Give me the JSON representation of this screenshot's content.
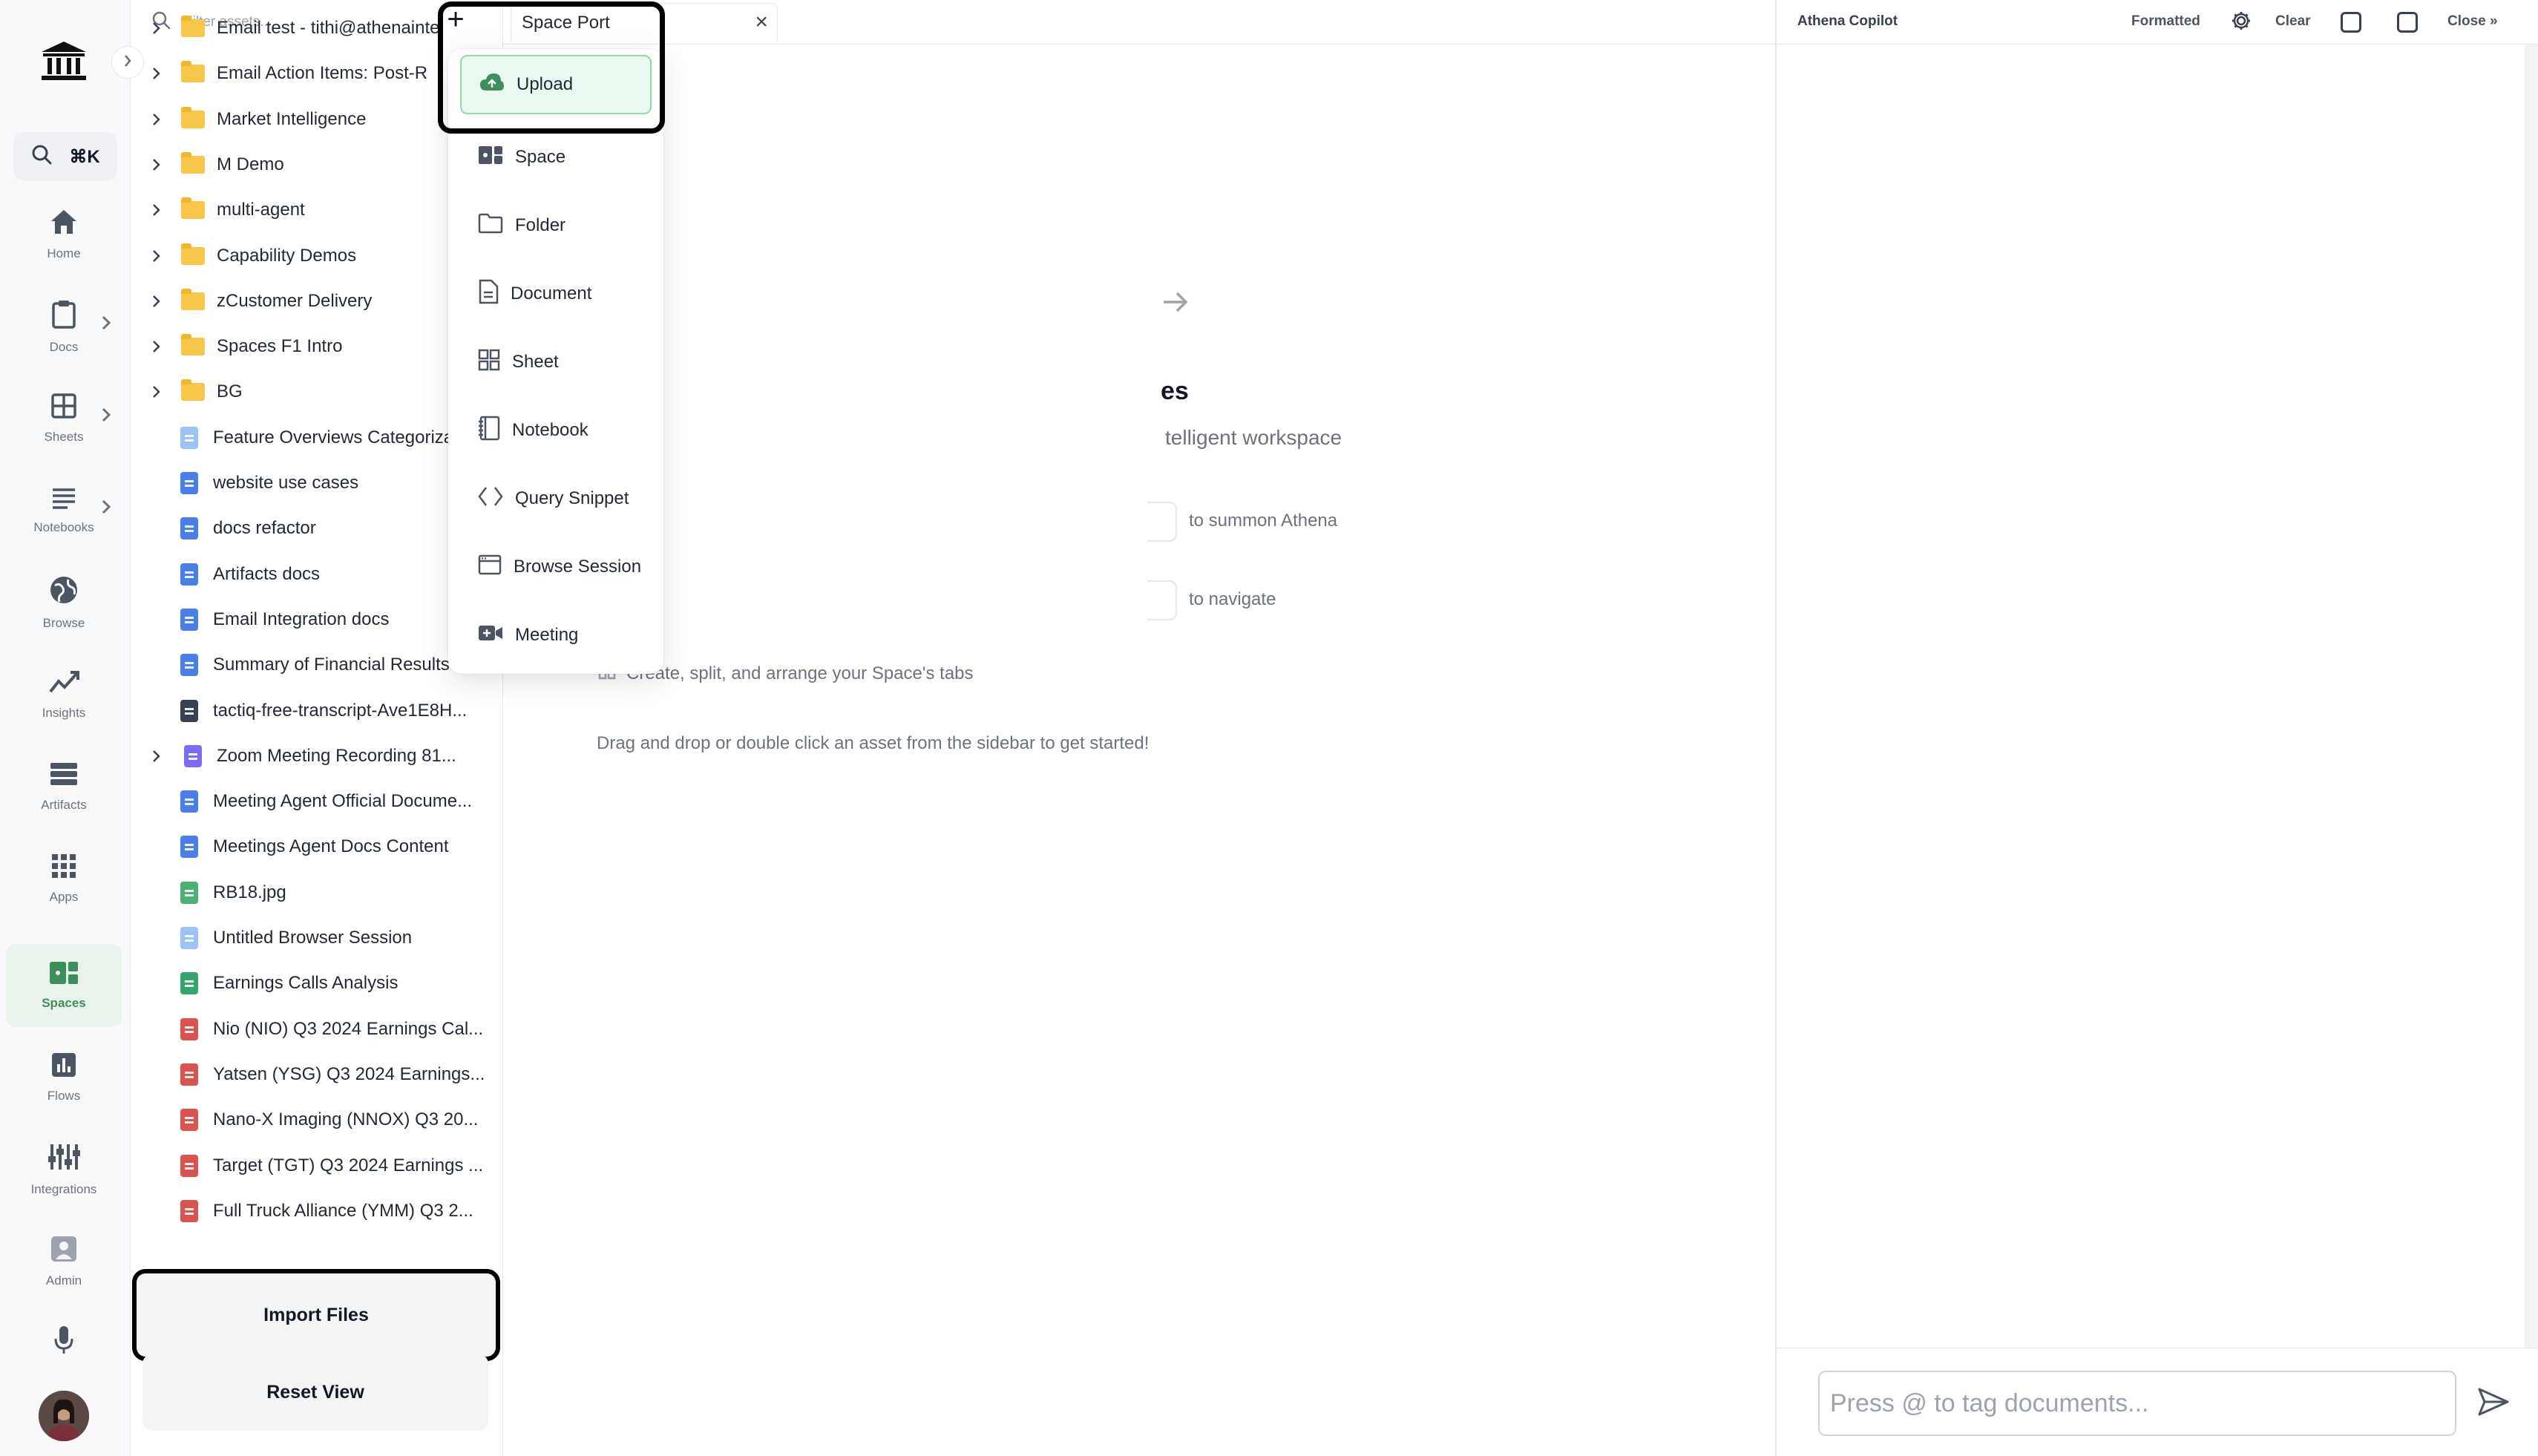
{
  "rail": {
    "search_shortcut": "⌘K",
    "items": [
      {
        "label": "Home",
        "icon": "home-icon"
      },
      {
        "label": "Docs",
        "icon": "clipboard-icon"
      },
      {
        "label": "Sheets",
        "icon": "grid-icon"
      },
      {
        "label": "Notebooks",
        "icon": "lines-icon"
      },
      {
        "label": "Browse",
        "icon": "globe-icon"
      },
      {
        "label": "Insights",
        "icon": "trend-icon"
      },
      {
        "label": "Artifacts",
        "icon": "stack-icon"
      },
      {
        "label": "Apps",
        "icon": "apps-grid-icon"
      },
      {
        "label": "Spaces",
        "icon": "spaces-icon",
        "active": true
      },
      {
        "label": "Flows",
        "icon": "bar-chart-icon"
      },
      {
        "label": "Integrations",
        "icon": "sliders-icon"
      },
      {
        "label": "Admin",
        "icon": "admin-icon"
      }
    ]
  },
  "assets": {
    "filter_placeholder": "Filter assets...",
    "items": [
      {
        "name": "Email test - tithi@athenaintel",
        "type": "folder"
      },
      {
        "name": "Email Action Items: Post-R",
        "type": "folder"
      },
      {
        "name": "Market Intelligence",
        "type": "folder"
      },
      {
        "name": "M Demo",
        "type": "folder"
      },
      {
        "name": "multi-agent",
        "type": "folder"
      },
      {
        "name": "Capability Demos",
        "type": "folder"
      },
      {
        "name": "zCustomer Delivery",
        "type": "folder"
      },
      {
        "name": "Spaces F1 Intro",
        "type": "folder"
      },
      {
        "name": "BG",
        "type": "folder"
      },
      {
        "name": "Feature Overviews Categorizat",
        "type": "browse"
      },
      {
        "name": "website use cases",
        "type": "doc"
      },
      {
        "name": "docs refactor",
        "type": "doc"
      },
      {
        "name": "Artifacts docs",
        "type": "doc"
      },
      {
        "name": "Email Integration docs",
        "type": "doc"
      },
      {
        "name": "Summary of Financial Results",
        "type": "doc"
      },
      {
        "name": "tactiq-free-transcript-Ave1E8H...",
        "type": "txt"
      },
      {
        "name": "Zoom Meeting Recording 81...",
        "type": "meeting"
      },
      {
        "name": "Meeting Agent Official Docume...",
        "type": "doc"
      },
      {
        "name": "Meetings Agent Docs Content",
        "type": "doc"
      },
      {
        "name": "RB18.jpg",
        "type": "image"
      },
      {
        "name": "Untitled Browser Session",
        "type": "browse"
      },
      {
        "name": "Earnings Calls Analysis",
        "type": "sheet"
      },
      {
        "name": "Nio (NIO) Q3 2024 Earnings Cal...",
        "type": "pdf"
      },
      {
        "name": "Yatsen (YSG) Q3 2024 Earnings...",
        "type": "pdf"
      },
      {
        "name": "Nano-X Imaging (NNOX) Q3 20...",
        "type": "pdf"
      },
      {
        "name": "Target (TGT) Q3 2024 Earnings ...",
        "type": "pdf"
      },
      {
        "name": "Full Truck Alliance (YMM) Q3 2...",
        "type": "pdf"
      }
    ],
    "import_label": "Import Files",
    "reset_label": "Reset View"
  },
  "tabs": {
    "plus": "+",
    "active_tab": "Space Port",
    "close": "×"
  },
  "menu": {
    "items": [
      {
        "label": "Upload",
        "icon": "upload-cloud-icon"
      },
      {
        "label": "Space",
        "icon": "space-icon"
      },
      {
        "label": "Folder",
        "icon": "folder-icon"
      },
      {
        "label": "Document",
        "icon": "document-icon"
      },
      {
        "label": "Sheet",
        "icon": "sheet-icon"
      },
      {
        "label": "Notebook",
        "icon": "notebook-icon"
      },
      {
        "label": "Query Snippet",
        "icon": "code-icon"
      },
      {
        "label": "Browse Session",
        "icon": "browser-window-icon"
      },
      {
        "label": "Meeting",
        "icon": "video-icon"
      }
    ]
  },
  "welcome": {
    "title": "es",
    "subtitle": "telligent workspace",
    "hint_summon": "to summon Athena",
    "hint_navigate": "to navigate",
    "hint_tabs": "Create, split, and arrange your Space's tabs",
    "drag_hint": "Drag and drop or double click an asset from the sidebar to get started!"
  },
  "copilot": {
    "title": "Athena Copilot",
    "formatted": "Formatted",
    "clear": "Clear",
    "close": "Close »",
    "input_placeholder": "Press @ to tag documents..."
  },
  "colors": {
    "accent_green": "#3f8f5d",
    "doc_blue": "#4a7fe8",
    "pdf_red": "#d9534f",
    "sheet_green": "#34a56c",
    "folder_yellow": "#f8c74a"
  }
}
